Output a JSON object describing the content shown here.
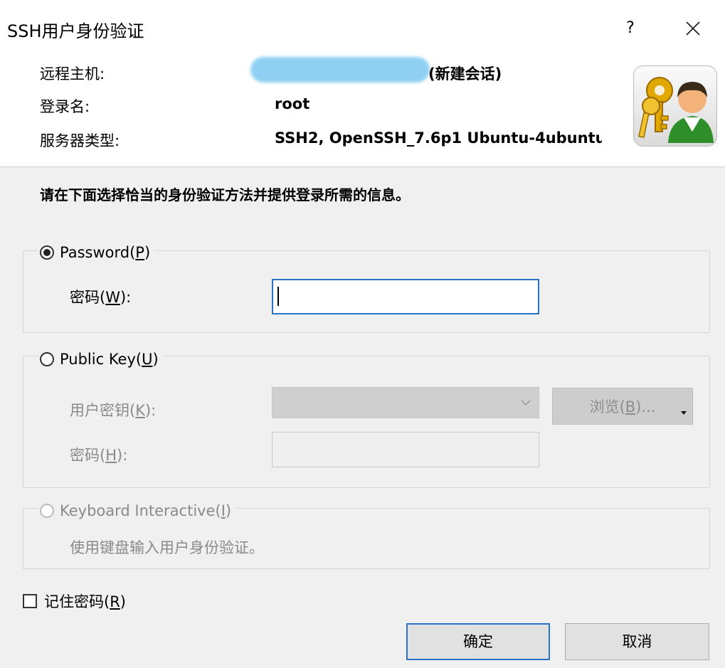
{
  "window": {
    "title": "SSH用户身份验证",
    "help_label": "?"
  },
  "header": {
    "remote_host_label": "远程主机:",
    "remote_host_suffix": "(新建会话)",
    "login_label": "登录名:",
    "login_value": "root",
    "server_type_label": "服务器类型:",
    "server_type_value": "SSH2, OpenSSH_7.6p1 Ubuntu-4ubuntu"
  },
  "instruction": "请在下面选择恰当的身份验证方法并提供登录所需的信息。",
  "password_group": {
    "radio_label": "Password(",
    "radio_mnemonic": "P",
    "radio_close": ")",
    "selected": true,
    "field_label": "密码(",
    "field_mnemonic": "W",
    "field_close": "):",
    "value": ""
  },
  "publickey_group": {
    "radio_label": "Public Key(",
    "radio_mnemonic": "U",
    "radio_close": ")",
    "selected": false,
    "key_label": "用户密钥(",
    "key_mnemonic": "K",
    "key_close": "):",
    "browse_label": "浏览(",
    "browse_mnemonic": "B",
    "browse_close": ")...",
    "pass_label": "密码(",
    "pass_mnemonic": "H",
    "pass_close": "):"
  },
  "keyboard_group": {
    "radio_label": "Keyboard Interactive(",
    "radio_mnemonic": "I",
    "radio_close": ")",
    "description": "使用键盘输入用户身份验证。"
  },
  "remember": {
    "label": "记住密码(",
    "mnemonic": "R",
    "close": ")",
    "checked": false
  },
  "buttons": {
    "ok": "确定",
    "cancel": "取消"
  }
}
